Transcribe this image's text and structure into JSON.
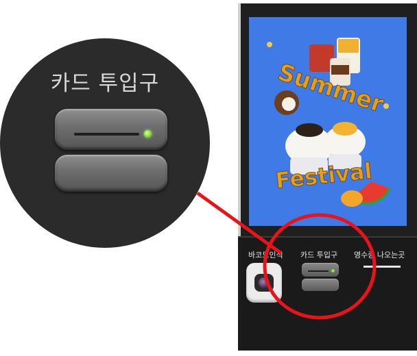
{
  "zoom": {
    "label": "카드 투입구"
  },
  "kiosk": {
    "poster": {
      "title_word1": "Summer",
      "title_word2": "Festival"
    },
    "labels": {
      "barcode": "바코드인식",
      "card": "카드 투입구",
      "receipt": "영수증 나오는곳"
    }
  },
  "colors": {
    "highlight": "#e8141b",
    "poster_bg": "#3f7ae6",
    "led": "#7dd83a",
    "title": "#e0a020"
  }
}
